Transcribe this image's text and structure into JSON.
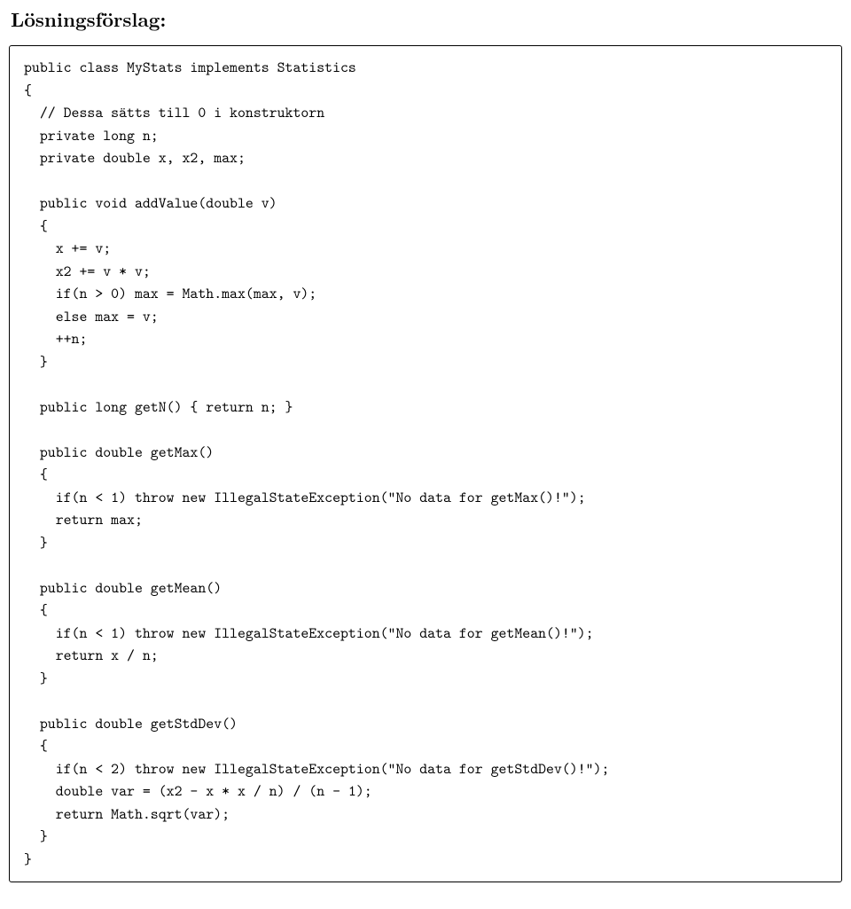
{
  "heading": "Lösningsförslag:",
  "code_lines": [
    "public class MyStats implements Statistics",
    "{",
    "  // Dessa sätts till 0 i konstruktorn",
    "  private long n;",
    "  private double x, x2, max;",
    "",
    "  public void addValue(double v)",
    "  {",
    "    x += v;",
    "    x2 += v * v;",
    "    if(n > 0) max = Math.max(max, v);",
    "    else max = v;",
    "    ++n;",
    "  }",
    "",
    "  public long getN() { return n; }",
    "",
    "  public double getMax()",
    "  {",
    "    if(n < 1) throw new IllegalStateException(\"No data for getMax()!\");",
    "    return max;",
    "  }",
    "",
    "  public double getMean()",
    "  {",
    "    if(n < 1) throw new IllegalStateException(\"No data for getMean()!\");",
    "    return x / n;",
    "  }",
    "",
    "  public double getStdDev()",
    "  {",
    "    if(n < 2) throw new IllegalStateException(\"No data for getStdDev()!\");",
    "    double var = (x2 - x * x / n) / (n - 1);",
    "    return Math.sqrt(var);",
    "  }",
    "}"
  ]
}
